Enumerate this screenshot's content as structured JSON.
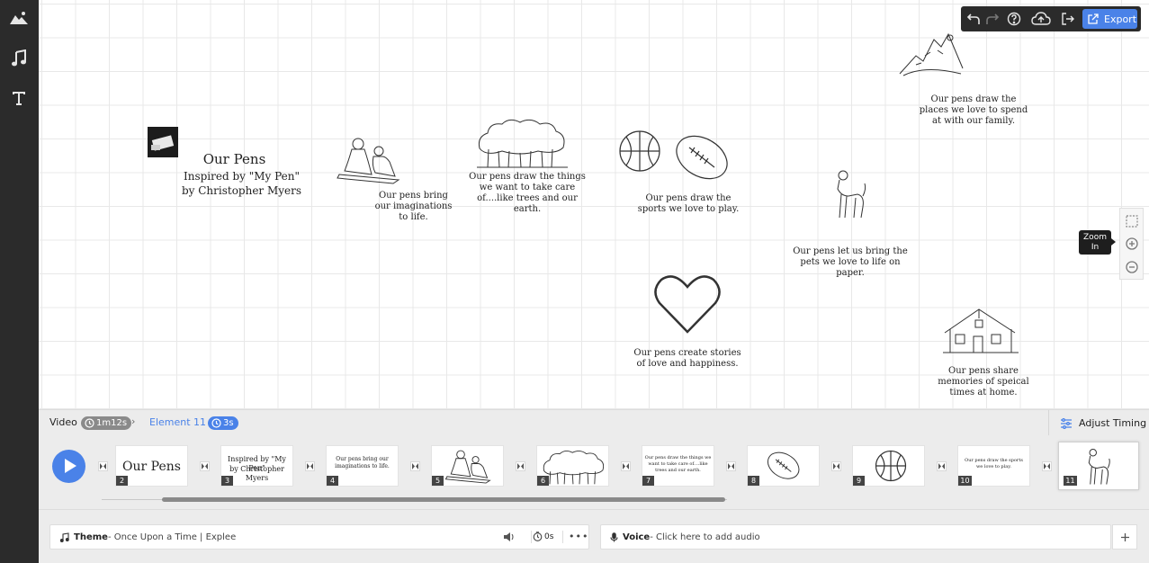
{
  "left_toolbar": {
    "icons": [
      "image-icon",
      "music-icon",
      "text-icon"
    ]
  },
  "canvas": {
    "title": "Our Pens",
    "subtitle_line1": "Inspired by \"My Pen\"",
    "subtitle_line2": "by Christopher Myers",
    "captions": {
      "imaginations": "Our pens bring our imaginations to life.",
      "trees": "Our pens draw the things we want to take care of....like trees and our earth.",
      "sports": "Our pens draw the sports we love to play.",
      "places": "Our pens draw the places we love to spend at with our family.",
      "pets": "Our pens let us bring the pets we love to life on paper.",
      "love": "Our pens create stories of love and happiness.",
      "home": "Our pens share memories of speical times at home."
    }
  },
  "top_toolbar": {
    "export_label": "Export"
  },
  "zoom": {
    "tooltip": "Zoom In"
  },
  "timeline": {
    "video_label": "Video",
    "video_duration": "1m12s",
    "element_label": "Element 11",
    "element_duration": "3s",
    "adjust_timing": "Adjust Timing",
    "frames": [
      {
        "num": "2",
        "text": "Our Pens"
      },
      {
        "num": "3",
        "text_line1": "Inspired by \"My Pen\"",
        "text_line2": "by Christopher Myers"
      },
      {
        "num": "4",
        "text": "Our pens bring our imaginations to life."
      },
      {
        "num": "5"
      },
      {
        "num": "6"
      },
      {
        "num": "7",
        "text": "Our pens draw the things we want to take care of....like trees and our earth."
      },
      {
        "num": "8"
      },
      {
        "num": "9"
      },
      {
        "num": "10",
        "text": "Our pens draw the sports we love to play."
      },
      {
        "num": "11"
      }
    ]
  },
  "audio": {
    "theme_label": "Theme",
    "theme_value": " - Once Upon a Time | Explee",
    "theme_time": "0s",
    "voice_label": "Voice",
    "voice_value": " - Click here to add audio"
  }
}
